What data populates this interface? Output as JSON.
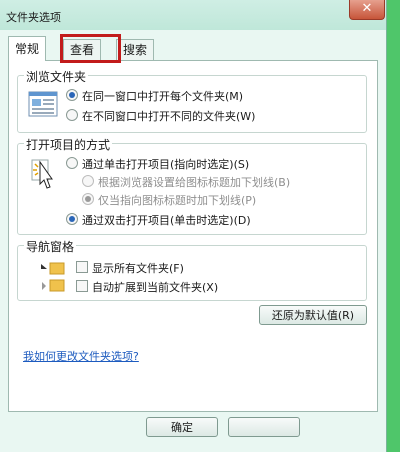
{
  "window": {
    "title": "文件夹选项",
    "close_glyph": "✕"
  },
  "tabs": [
    {
      "label": "常规",
      "active": true
    },
    {
      "label": "查看",
      "active": false,
      "highlighted": true
    },
    {
      "label": "搜索",
      "active": false
    }
  ],
  "browse_folders": {
    "title": "浏览文件夹",
    "icon": "browse-folders-icon",
    "options": [
      {
        "label": "在同一窗口中打开每个文件夹(M)",
        "checked": true
      },
      {
        "label": "在不同窗口中打开不同的文件夹(W)",
        "checked": false
      }
    ]
  },
  "open_items": {
    "title": "打开项目的方式",
    "icon": "click-items-icon",
    "single_click": {
      "label": "通过单击打开项目(指向时选定)(S)",
      "checked": false
    },
    "sub_options": [
      {
        "label": "根据浏览器设置给图标标题加下划线(B)",
        "checked": false,
        "disabled": true
      },
      {
        "label": "仅当指向图标标题时加下划线(P)",
        "checked": true,
        "disabled": true
      }
    ],
    "double_click": {
      "label": "通过双击打开项目(单击时选定)(D)",
      "checked": true
    }
  },
  "navigation_pane": {
    "title": "导航窗格",
    "options": [
      {
        "label": "显示所有文件夹(F)",
        "checked": false
      },
      {
        "label": "自动扩展到当前文件夹(X)",
        "checked": false
      }
    ]
  },
  "restore_defaults_label": "还原为默认值(R)",
  "help_link": "我如何更改文件夹选项?",
  "buttons": {
    "ok": "确定",
    "cancel": ""
  },
  "colors": {
    "highlight_border": "#c21b1b",
    "link": "#1d5bbf",
    "radio_dot": "#2a66b8"
  }
}
